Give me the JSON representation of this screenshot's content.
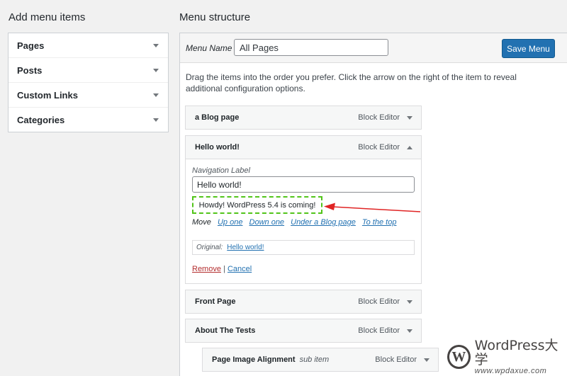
{
  "left_panel": {
    "title": "Add menu items",
    "items": [
      {
        "label": "Pages"
      },
      {
        "label": "Posts"
      },
      {
        "label": "Custom Links"
      },
      {
        "label": "Categories"
      }
    ]
  },
  "right_panel": {
    "title": "Menu structure",
    "menu_name_label": "Menu Name",
    "menu_name_value": "All Pages",
    "save_button": "Save Menu",
    "instructions": "Drag the items into the order you prefer. Click the arrow on the right of the item to reveal additional configuration options."
  },
  "menu_items": {
    "blog": {
      "title": "a Blog page",
      "type": "Block Editor"
    },
    "hello": {
      "title": "Hello world!",
      "type": "Block Editor"
    },
    "front": {
      "title": "Front Page",
      "type": "Block Editor"
    },
    "about": {
      "title": "About The Tests",
      "type": "Block Editor"
    },
    "alignment": {
      "title": "Page Image Alignment",
      "sub": "sub item",
      "type": "Block Editor"
    }
  },
  "settings": {
    "nav_label_caption": "Navigation Label",
    "nav_label_value": "Hello world!",
    "notice": "Howdy! WordPress 5.4 is coming!",
    "move_label": "Move",
    "move_links": [
      "Up one",
      "Down one",
      "Under a Blog page",
      "To the top"
    ],
    "original_label": "Original:",
    "original_link": "Hello world!",
    "remove": "Remove",
    "separator": "|",
    "cancel": "Cancel"
  },
  "watermark": {
    "title": "WordPress大学",
    "url": "www.wpdaxue.com"
  },
  "colors": {
    "primary": "#2271b1",
    "notice_border": "#52c41a",
    "arrow": "#e02424",
    "remove": "#b32d2e"
  }
}
